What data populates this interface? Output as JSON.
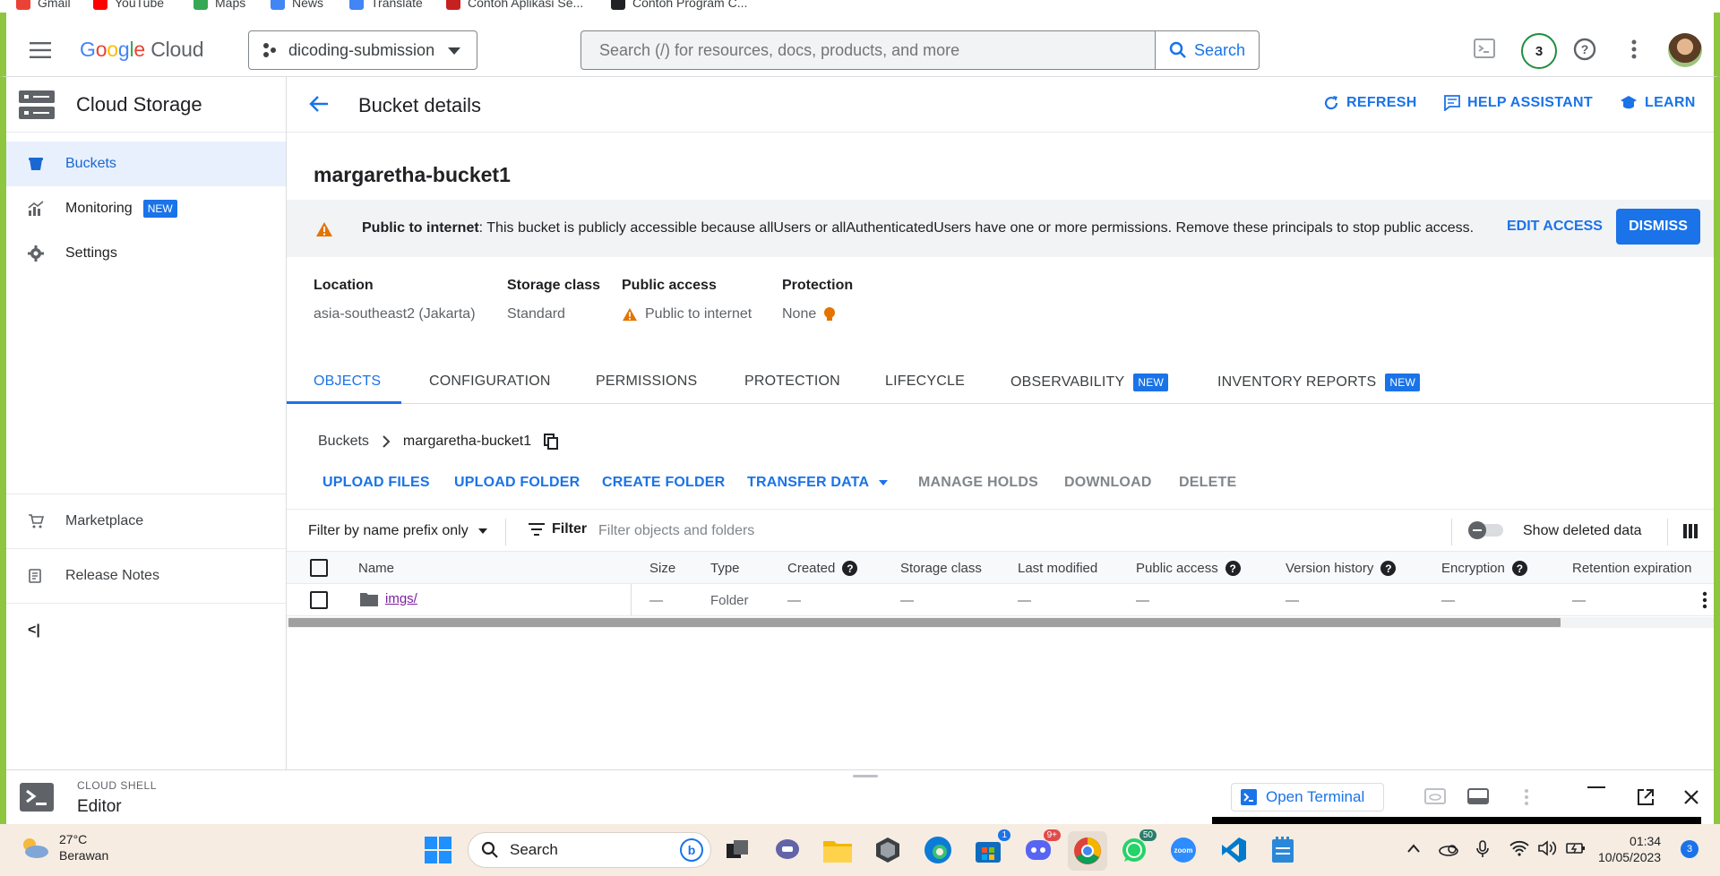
{
  "bookmarks": [
    {
      "label": "Gmail",
      "color": "#ea4335"
    },
    {
      "label": "YouTube",
      "color": "#ff0000"
    },
    {
      "label": "Maps",
      "color": "#34a853"
    },
    {
      "label": "News",
      "color": "#4285f4"
    },
    {
      "label": "Translate",
      "color": "#4285f4"
    },
    {
      "label": "Contoh Aplikasi Se...",
      "color": "#c5221f"
    },
    {
      "label": "Contoh Program C...",
      "color": "#202124"
    }
  ],
  "topbar": {
    "logo_google": "Google",
    "logo_cloud": "Cloud",
    "project": "dicoding-submission",
    "search_placeholder": "Search (/) for resources, docs, products, and more",
    "search_button": "Search",
    "notification_count": "3"
  },
  "sidebar": {
    "title": "Cloud Storage",
    "items": [
      {
        "label": "Buckets",
        "icon": "bucket-icon",
        "active": true
      },
      {
        "label": "Monitoring",
        "icon": "monitoring-icon",
        "badge": "NEW"
      },
      {
        "label": "Settings",
        "icon": "gear-icon"
      }
    ],
    "bottom": [
      {
        "label": "Marketplace",
        "icon": "cart-icon"
      },
      {
        "label": "Release Notes",
        "icon": "release-notes-icon"
      }
    ],
    "collapse": "<|"
  },
  "page": {
    "title": "Bucket details",
    "refresh": "REFRESH",
    "help": "HELP ASSISTANT",
    "learn": "LEARN",
    "bucket_name": "margaretha-bucket1"
  },
  "alert": {
    "bold": "Public to internet",
    "text": ": This bucket is publicly accessible because allUsers or allAuthenticatedUsers have one or more permissions. Remove these principals to stop public access.",
    "edit": "EDIT ACCESS",
    "dismiss": "DISMISS"
  },
  "meta": {
    "location_label": "Location",
    "location_value": "asia-southeast2 (Jakarta)",
    "class_label": "Storage class",
    "class_value": "Standard",
    "access_label": "Public access",
    "access_value": "Public to internet",
    "protection_label": "Protection",
    "protection_value": "None"
  },
  "tabs": [
    {
      "label": "OBJECTS",
      "active": true
    },
    {
      "label": "CONFIGURATION"
    },
    {
      "label": "PERMISSIONS"
    },
    {
      "label": "PROTECTION"
    },
    {
      "label": "LIFECYCLE"
    },
    {
      "label": "OBSERVABILITY",
      "badge": "NEW"
    },
    {
      "label": "INVENTORY REPORTS",
      "badge": "NEW"
    }
  ],
  "breadcrumb": {
    "root": "Buckets",
    "current": "margaretha-bucket1"
  },
  "actions": {
    "upload_files": "UPLOAD FILES",
    "upload_folder": "UPLOAD FOLDER",
    "create_folder": "CREATE FOLDER",
    "transfer_data": "TRANSFER DATA",
    "manage_holds": "MANAGE HOLDS",
    "download": "DOWNLOAD",
    "delete": "DELETE"
  },
  "filter": {
    "prefix": "Filter by name prefix only",
    "filter_label": "Filter",
    "placeholder": "Filter objects and folders",
    "show_deleted": "Show deleted data"
  },
  "table": {
    "headers": {
      "name": "Name",
      "size": "Size",
      "type": "Type",
      "created": "Created",
      "storage_class": "Storage class",
      "last_modified": "Last modified",
      "public_access": "Public access",
      "version_history": "Version history",
      "encryption": "Encryption",
      "retention": "Retention expiration"
    },
    "row": {
      "name": "imgs/",
      "size": "—",
      "type": "Folder",
      "created": "—",
      "storage_class": "—",
      "last_modified": "—",
      "public_access": "—",
      "version_history": "—",
      "encryption": "—",
      "retention": "—"
    }
  },
  "cloud_shell": {
    "label": "CLOUD SHELL",
    "mode": "Editor",
    "open_terminal": "Open Terminal"
  },
  "taskbar": {
    "temp": "27°C",
    "weather": "Berawan",
    "search": "Search",
    "badges": {
      "teams": "1",
      "discord": "9+",
      "whatsapp": "50"
    },
    "zoom_label": "zoom",
    "time": "01:34",
    "date": "10/05/2023",
    "notifications": "3"
  },
  "colors": {
    "accent": "#1a73e8",
    "warning": "#e37400",
    "frame": "#8ec63f"
  }
}
